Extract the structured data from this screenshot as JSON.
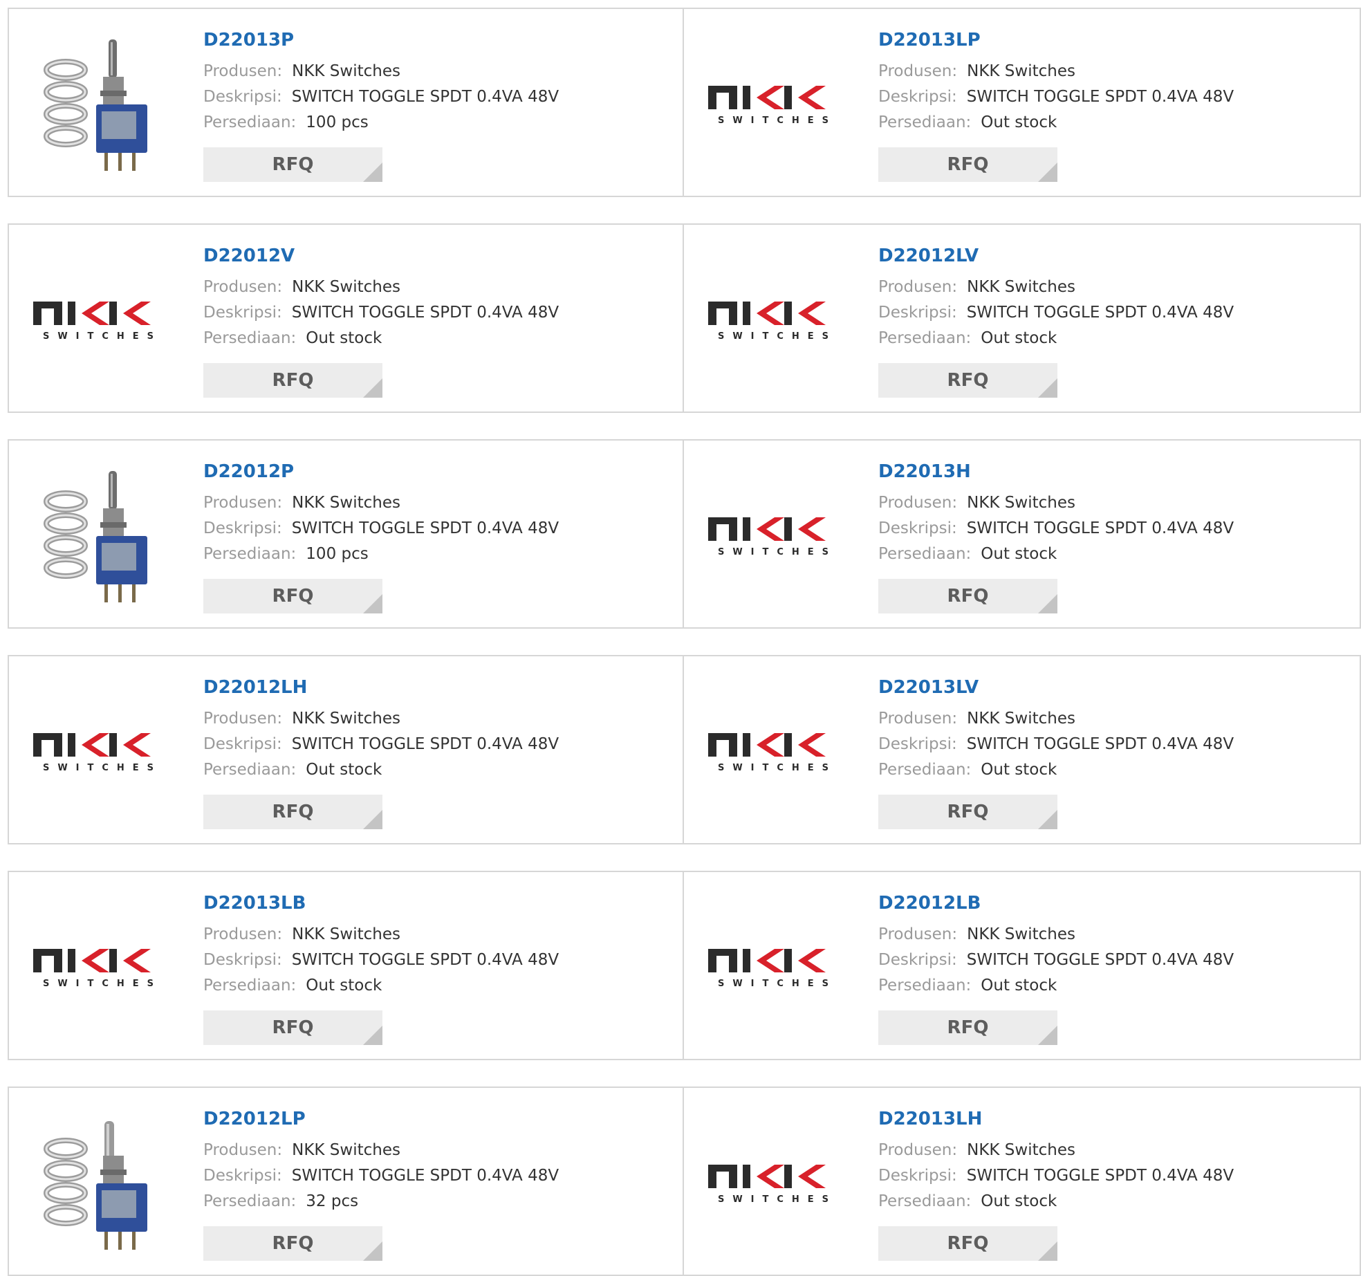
{
  "labels": {
    "manufacturer": "Produsen:",
    "description": "Deskripsi:",
    "stock": "Persediaan:",
    "rfq": "RFQ"
  },
  "logo": {
    "brand_text": "NKK",
    "tagline": "SWITCHES"
  },
  "colors": {
    "part_link": "#1f6bb3",
    "label": "#9a9a9a",
    "value": "#333333",
    "rfq_bg": "#ececec",
    "logo_dark": "#2b2b2b",
    "logo_red": "#d8212a"
  },
  "products": [
    {
      "part": "D22013P",
      "manufacturer": "NKK Switches",
      "description": "SWITCH TOGGLE SPDT 0.4VA 48V",
      "stock": "100 pcs",
      "image": "toggle-switch-photo"
    },
    {
      "part": "D22013LP",
      "manufacturer": "NKK Switches",
      "description": "SWITCH TOGGLE SPDT 0.4VA 48V",
      "stock": "Out stock",
      "image": "nkk-logo"
    },
    {
      "part": "D22012V",
      "manufacturer": "NKK Switches",
      "description": "SWITCH TOGGLE SPDT 0.4VA 48V",
      "stock": "Out stock",
      "image": "nkk-logo"
    },
    {
      "part": "D22012LV",
      "manufacturer": "NKK Switches",
      "description": "SWITCH TOGGLE SPDT 0.4VA 48V",
      "stock": "Out stock",
      "image": "nkk-logo"
    },
    {
      "part": "D22012P",
      "manufacturer": "NKK Switches",
      "description": "SWITCH TOGGLE SPDT 0.4VA 48V",
      "stock": "100 pcs",
      "image": "toggle-switch-photo"
    },
    {
      "part": "D22013H",
      "manufacturer": "NKK Switches",
      "description": "SWITCH TOGGLE SPDT 0.4VA 48V",
      "stock": "Out stock",
      "image": "nkk-logo"
    },
    {
      "part": "D22012LH",
      "manufacturer": "NKK Switches",
      "description": "SWITCH TOGGLE SPDT 0.4VA 48V",
      "stock": "Out stock",
      "image": "nkk-logo"
    },
    {
      "part": "D22013LV",
      "manufacturer": "NKK Switches",
      "description": "SWITCH TOGGLE SPDT 0.4VA 48V",
      "stock": "Out stock",
      "image": "nkk-logo"
    },
    {
      "part": "D22013LB",
      "manufacturer": "NKK Switches",
      "description": "SWITCH TOGGLE SPDT 0.4VA 48V",
      "stock": "Out stock",
      "image": "nkk-logo"
    },
    {
      "part": "D22012LB",
      "manufacturer": "NKK Switches",
      "description": "SWITCH TOGGLE SPDT 0.4VA 48V",
      "stock": "Out stock",
      "image": "nkk-logo"
    },
    {
      "part": "D22012LP",
      "manufacturer": "NKK Switches",
      "description": "SWITCH TOGGLE SPDT 0.4VA 48V",
      "stock": "32 pcs",
      "image": "toggle-switch-long-photo"
    },
    {
      "part": "D22013LH",
      "manufacturer": "NKK Switches",
      "description": "SWITCH TOGGLE SPDT 0.4VA 48V",
      "stock": "Out stock",
      "image": "nkk-logo"
    }
  ]
}
